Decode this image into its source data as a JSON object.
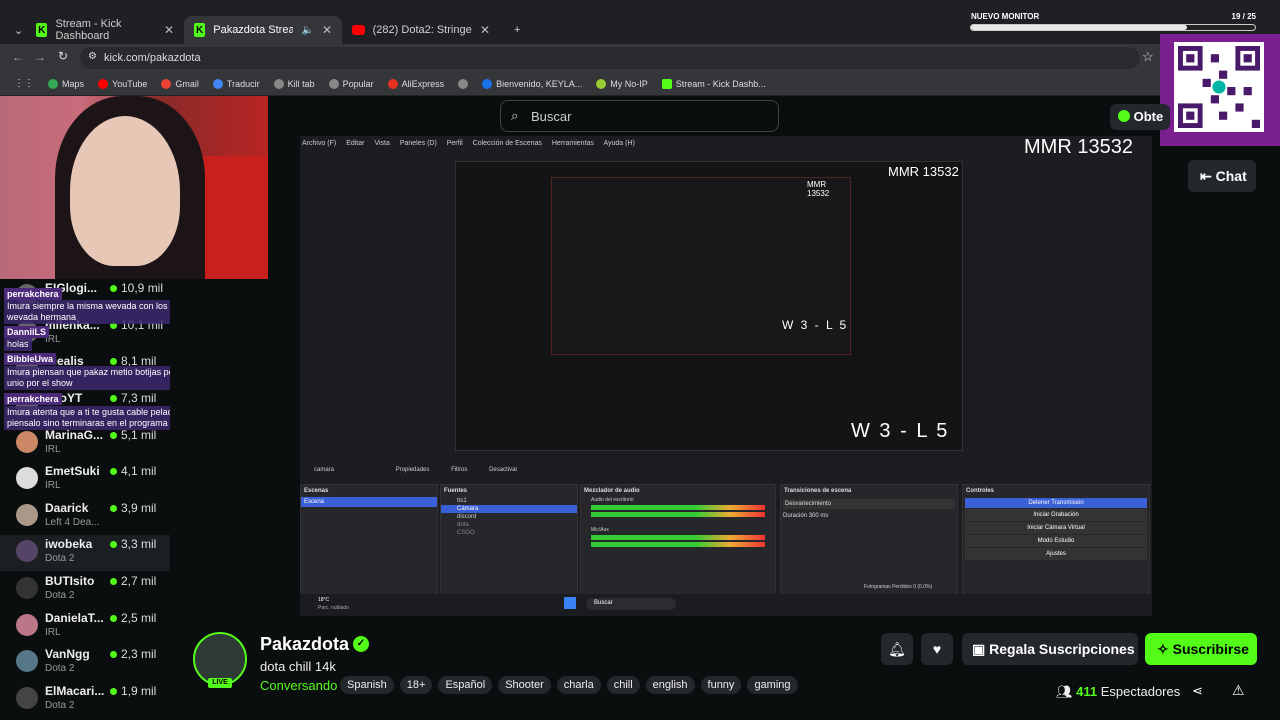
{
  "browser": {
    "tabs": [
      {
        "label": "Stream - Kick Dashboard"
      },
      {
        "label": "Pakazdota Stream - Watch"
      },
      {
        "label": "(282) Dota2: Stringer firmó a la"
      }
    ],
    "url": "kick.com/pakazdota",
    "bookmarks": [
      "Maps",
      "YouTube",
      "Gmail",
      "Traducir",
      "Kill tab",
      "Popular",
      "AliExpress",
      "Bienvenido, KEYLA...",
      "My No-IP",
      "Stream - Kick Dashb..."
    ]
  },
  "overlay": {
    "monitor_label": "NUEVO MONITOR",
    "monitor_count": "19 / 25",
    "monitor_progress": 0.76
  },
  "header": {
    "search_placeholder": "Buscar",
    "obtener_label": "Obte",
    "chat_label": "Chat"
  },
  "sidebar": {
    "channels": [
      {
        "name": "EIGlogi...",
        "viewers": "10,9 mil",
        "category": ""
      },
      {
        "name": "milenka...",
        "viewers": "10,1 mil",
        "category": "IRL"
      },
      {
        "name": "Diealis",
        "viewers": "8,1 mil",
        "category": ""
      },
      {
        "name": "...roYT",
        "viewers": "7,3 mil",
        "category": ""
      },
      {
        "name": "MarinaG...",
        "viewers": "5,1 mil",
        "category": "IRL"
      },
      {
        "name": "EmetSuki",
        "viewers": "4,1 mil",
        "category": "IRL"
      },
      {
        "name": "Daarick",
        "viewers": "3,9 mil",
        "category": "Left 4 Dea..."
      },
      {
        "name": "iwobeka",
        "viewers": "3,3 mil",
        "category": "Dota 2"
      },
      {
        "name": "BUTIsito",
        "viewers": "2,7 mil",
        "category": "Dota 2"
      },
      {
        "name": "DanielaT...",
        "viewers": "2,5 mil",
        "category": "IRL"
      },
      {
        "name": "VanNgg",
        "viewers": "2,3 mil",
        "category": "Dota 2"
      },
      {
        "name": "ElMacari...",
        "viewers": "1,9 mil",
        "category": "Dota 2"
      }
    ],
    "chat": [
      {
        "user": "perrakchera",
        "msg": "Imura siempre la misma wevada con los doteros fea wevada hermana"
      },
      {
        "user": "DanniiLS",
        "msg": "holas"
      },
      {
        "user": "BibbleUwa",
        "msg": "Imura piensan que pakaz metio botijas pero la gente se unio por el show"
      },
      {
        "user": "perrakchera",
        "msg": "Imura atenta que a ti te gusta cable pelao asi que piensalo sino terminaras en el programa de andrea"
      }
    ]
  },
  "stream": {
    "mmr": "MMR 13532",
    "score": "W 3 - L 5",
    "obs": {
      "menu": [
        "Archivo (F)",
        "Editar",
        "Vista",
        "Paneles (D)",
        "Perfil",
        "Colección de Escenas",
        "Herramientas",
        "Ayuda (H)"
      ],
      "source_name": "camara",
      "properties": "Propiedades",
      "filters": "Filtros",
      "deactivate": "Desactivar",
      "docks": {
        "scenes_title": "Escenas",
        "scene_item": "Escena",
        "sources_title": "Fuentes",
        "sources": [
          "tts1",
          "Cámara",
          "discord",
          "dota",
          "CSGO"
        ],
        "mixer_title": "Mezclador de audio",
        "mixer_tracks": [
          "Audio del escritorio",
          "Mic/Aux"
        ],
        "transitions_title": "Transiciones de escena",
        "transition": "Desvanecimiento",
        "duration_label": "Duración",
        "duration": "300 ms",
        "controls_title": "Controles",
        "controls": [
          "Detener Transmisión",
          "Iniciar Grabación",
          "Iniciar Cámara Virtual",
          "Modo Estudio",
          "Ajustes"
        ]
      },
      "status": "Fotogramas Perdidos 0 (0.0%)",
      "weather": "18°C",
      "weather_desc": "Parc. nublado",
      "taskbar_search": "Buscar"
    }
  },
  "info": {
    "streamer": "Pakazdota",
    "live_label": "LIVE",
    "title": "dota chill 14k",
    "category": "Conversando",
    "tags": [
      "Spanish",
      "18+",
      "Español",
      "Shooter",
      "charla",
      "chill",
      "english",
      "funny",
      "gaming"
    ],
    "gift_label": "Regala Suscripciones",
    "subscribe_label": "Suscribirse",
    "viewers_count": "411",
    "viewers_label": "Espectadores"
  },
  "colors": {
    "kick_green": "#53fc18",
    "background": "#0b0e0f"
  }
}
